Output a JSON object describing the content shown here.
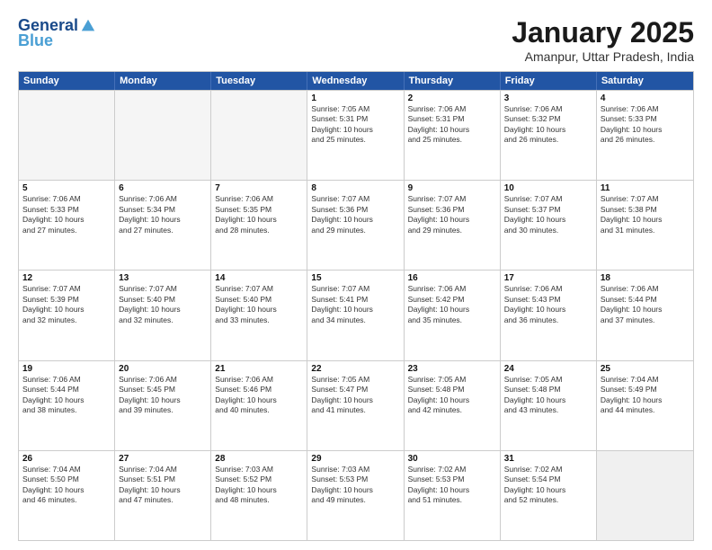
{
  "header": {
    "logo_general": "General",
    "logo_blue": "Blue",
    "month_title": "January 2025",
    "location": "Amanpur, Uttar Pradesh, India"
  },
  "weekdays": [
    "Sunday",
    "Monday",
    "Tuesday",
    "Wednesday",
    "Thursday",
    "Friday",
    "Saturday"
  ],
  "rows": [
    [
      {
        "day": "",
        "text": "",
        "empty": true
      },
      {
        "day": "",
        "text": "",
        "empty": true
      },
      {
        "day": "",
        "text": "",
        "empty": true
      },
      {
        "day": "1",
        "text": "Sunrise: 7:05 AM\nSunset: 5:31 PM\nDaylight: 10 hours\nand 25 minutes."
      },
      {
        "day": "2",
        "text": "Sunrise: 7:06 AM\nSunset: 5:31 PM\nDaylight: 10 hours\nand 25 minutes."
      },
      {
        "day": "3",
        "text": "Sunrise: 7:06 AM\nSunset: 5:32 PM\nDaylight: 10 hours\nand 26 minutes."
      },
      {
        "day": "4",
        "text": "Sunrise: 7:06 AM\nSunset: 5:33 PM\nDaylight: 10 hours\nand 26 minutes."
      }
    ],
    [
      {
        "day": "5",
        "text": "Sunrise: 7:06 AM\nSunset: 5:33 PM\nDaylight: 10 hours\nand 27 minutes."
      },
      {
        "day": "6",
        "text": "Sunrise: 7:06 AM\nSunset: 5:34 PM\nDaylight: 10 hours\nand 27 minutes."
      },
      {
        "day": "7",
        "text": "Sunrise: 7:06 AM\nSunset: 5:35 PM\nDaylight: 10 hours\nand 28 minutes."
      },
      {
        "day": "8",
        "text": "Sunrise: 7:07 AM\nSunset: 5:36 PM\nDaylight: 10 hours\nand 29 minutes."
      },
      {
        "day": "9",
        "text": "Sunrise: 7:07 AM\nSunset: 5:36 PM\nDaylight: 10 hours\nand 29 minutes."
      },
      {
        "day": "10",
        "text": "Sunrise: 7:07 AM\nSunset: 5:37 PM\nDaylight: 10 hours\nand 30 minutes."
      },
      {
        "day": "11",
        "text": "Sunrise: 7:07 AM\nSunset: 5:38 PM\nDaylight: 10 hours\nand 31 minutes."
      }
    ],
    [
      {
        "day": "12",
        "text": "Sunrise: 7:07 AM\nSunset: 5:39 PM\nDaylight: 10 hours\nand 32 minutes."
      },
      {
        "day": "13",
        "text": "Sunrise: 7:07 AM\nSunset: 5:40 PM\nDaylight: 10 hours\nand 32 minutes."
      },
      {
        "day": "14",
        "text": "Sunrise: 7:07 AM\nSunset: 5:40 PM\nDaylight: 10 hours\nand 33 minutes."
      },
      {
        "day": "15",
        "text": "Sunrise: 7:07 AM\nSunset: 5:41 PM\nDaylight: 10 hours\nand 34 minutes."
      },
      {
        "day": "16",
        "text": "Sunrise: 7:06 AM\nSunset: 5:42 PM\nDaylight: 10 hours\nand 35 minutes."
      },
      {
        "day": "17",
        "text": "Sunrise: 7:06 AM\nSunset: 5:43 PM\nDaylight: 10 hours\nand 36 minutes."
      },
      {
        "day": "18",
        "text": "Sunrise: 7:06 AM\nSunset: 5:44 PM\nDaylight: 10 hours\nand 37 minutes."
      }
    ],
    [
      {
        "day": "19",
        "text": "Sunrise: 7:06 AM\nSunset: 5:44 PM\nDaylight: 10 hours\nand 38 minutes."
      },
      {
        "day": "20",
        "text": "Sunrise: 7:06 AM\nSunset: 5:45 PM\nDaylight: 10 hours\nand 39 minutes."
      },
      {
        "day": "21",
        "text": "Sunrise: 7:06 AM\nSunset: 5:46 PM\nDaylight: 10 hours\nand 40 minutes."
      },
      {
        "day": "22",
        "text": "Sunrise: 7:05 AM\nSunset: 5:47 PM\nDaylight: 10 hours\nand 41 minutes."
      },
      {
        "day": "23",
        "text": "Sunrise: 7:05 AM\nSunset: 5:48 PM\nDaylight: 10 hours\nand 42 minutes."
      },
      {
        "day": "24",
        "text": "Sunrise: 7:05 AM\nSunset: 5:48 PM\nDaylight: 10 hours\nand 43 minutes."
      },
      {
        "day": "25",
        "text": "Sunrise: 7:04 AM\nSunset: 5:49 PM\nDaylight: 10 hours\nand 44 minutes."
      }
    ],
    [
      {
        "day": "26",
        "text": "Sunrise: 7:04 AM\nSunset: 5:50 PM\nDaylight: 10 hours\nand 46 minutes."
      },
      {
        "day": "27",
        "text": "Sunrise: 7:04 AM\nSunset: 5:51 PM\nDaylight: 10 hours\nand 47 minutes."
      },
      {
        "day": "28",
        "text": "Sunrise: 7:03 AM\nSunset: 5:52 PM\nDaylight: 10 hours\nand 48 minutes."
      },
      {
        "day": "29",
        "text": "Sunrise: 7:03 AM\nSunset: 5:53 PM\nDaylight: 10 hours\nand 49 minutes."
      },
      {
        "day": "30",
        "text": "Sunrise: 7:02 AM\nSunset: 5:53 PM\nDaylight: 10 hours\nand 51 minutes."
      },
      {
        "day": "31",
        "text": "Sunrise: 7:02 AM\nSunset: 5:54 PM\nDaylight: 10 hours\nand 52 minutes."
      },
      {
        "day": "",
        "text": "",
        "empty": true,
        "shaded": true
      }
    ]
  ]
}
